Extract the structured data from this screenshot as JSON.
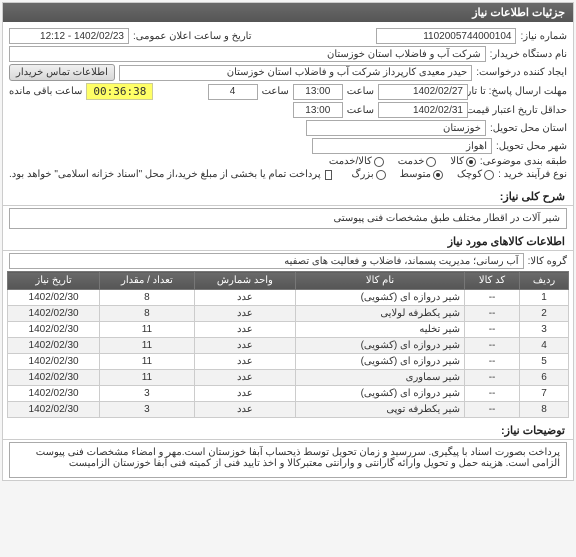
{
  "panel_title": "جزئیات اطلاعات نیاز",
  "fields": {
    "need_no_label": "شماره نیاز:",
    "need_no": "1102005744000104",
    "announce_label": "تاریخ و ساعت اعلان عمومی:",
    "announce_val": "1402/02/23 - 12:12",
    "buyer_label": "نام دستگاه خریدار:",
    "buyer_val": "شرکت آب و فاضلاب استان خوزستان",
    "creator_label": "ایجاد کننده درخواست:",
    "creator_val": "حیدر معیدی کارپرداز شرکت آب و فاضلاب استان خوزستان",
    "contact_btn": "اطلاعات تماس خریدار",
    "deadline_label": "مهلت ارسال پاسخ: تا تاریخ:",
    "deadline_date": "1402/02/27",
    "time_label": "ساعت",
    "deadline_hh": "13:00",
    "deadline_mm": "4",
    "remaining_label": "ساعت باقی مانده",
    "timer": "00:36:38",
    "validity_label": "حداقل تاریخ اعتبار قیمت: تا تاریخ:",
    "validity_date": "1402/02/31",
    "validity_hh": "13:00",
    "province_label": "استان محل تحویل:",
    "province_val": "خوزستان",
    "city_label": "شهر محل تحویل:",
    "city_val": "اهواز",
    "subject_type_label": "طبقه بندی موضوعی:",
    "opt_kala": "کالا",
    "opt_khedmat": "خدمت",
    "opt_kalakhedmat": "کالا/خدمت",
    "process_label": "نوع فرآیند خرید :",
    "opt_kochak": "کوچک",
    "opt_motevaset": "متوسط",
    "opt_bozorg": "بزرگ",
    "treasury_note": "پرداخت تمام یا بخشی از مبلغ خرید،از محل \"اسناد خزانه اسلامی\" خواهد بود."
  },
  "summary": {
    "title": "شرح کلی نیاز:",
    "text": "شیر آلات در اقطار مختلف طبق مشخصات فنی پیوستی"
  },
  "items_section": {
    "title": "اطلاعات کالاهای مورد نیاز",
    "group_label": "گروه کالا:",
    "group_val": "آب رسانی؛ مدیریت پسماند، فاضلاب و فعالیت های تصفیه",
    "headers": {
      "row": "ردیف",
      "code": "کد کالا",
      "name": "نام کالا",
      "unit": "واحد شمارش",
      "qty": "تعداد / مقدار",
      "date": "تاریخ نیاز"
    },
    "rows": [
      {
        "n": "1",
        "code": "--",
        "name": "شیر دروازه ای (کشویی)",
        "unit": "عدد",
        "qty": "8",
        "date": "1402/02/30"
      },
      {
        "n": "2",
        "code": "--",
        "name": "شیر یکطرفه لولایی",
        "unit": "عدد",
        "qty": "8",
        "date": "1402/02/30"
      },
      {
        "n": "3",
        "code": "--",
        "name": "شیر تخلیه",
        "unit": "عدد",
        "qty": "11",
        "date": "1402/02/30"
      },
      {
        "n": "4",
        "code": "--",
        "name": "شیر دروازه ای (کشویی)",
        "unit": "عدد",
        "qty": "11",
        "date": "1402/02/30"
      },
      {
        "n": "5",
        "code": "--",
        "name": "شیر دروازه ای (کشویی)",
        "unit": "عدد",
        "qty": "11",
        "date": "1402/02/30"
      },
      {
        "n": "6",
        "code": "--",
        "name": "شیر سماوری",
        "unit": "عدد",
        "qty": "11",
        "date": "1402/02/30"
      },
      {
        "n": "7",
        "code": "--",
        "name": "شیر دروازه ای (کشویی)",
        "unit": "عدد",
        "qty": "3",
        "date": "1402/02/30"
      },
      {
        "n": "8",
        "code": "--",
        "name": "شیر یکطرفه توپی",
        "unit": "عدد",
        "qty": "3",
        "date": "1402/02/30"
      }
    ]
  },
  "notes": {
    "title": "توضیحات نیاز:",
    "text": "پرداخت بصورت اسناد با پیگیری.  سررسید و زمان تحویل توسط ذیحساب آبفا خوزستان است.مهر و امضاء مشخصات فنی پیوست الزامی است. هزینه حمل و تحویل وارائه گارانتی و وارانتی معتبرکالا و اخذ تایید فنی از کمیته فنی آبفا خوزستان الزامیست"
  }
}
